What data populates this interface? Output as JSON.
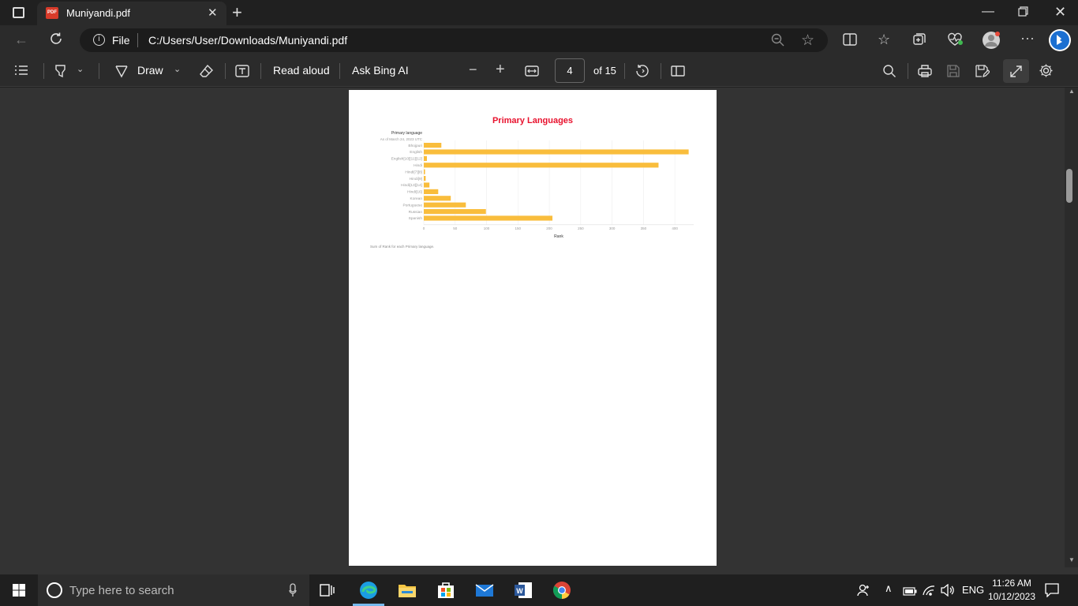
{
  "browser": {
    "tab_title": "Muniyandi.pdf",
    "pdf_badge": "PDF",
    "address_label": "File",
    "url": "C:/Users/User/Downloads/Muniyandi.pdf"
  },
  "pdf_toolbar": {
    "draw_label": "Draw",
    "read_aloud_label": "Read aloud",
    "ask_bing_label": "Ask Bing AI",
    "current_page": "4",
    "page_total": "of 15"
  },
  "chart_data": {
    "type": "bar",
    "orientation": "horizontal",
    "title": "Primary Languages",
    "ylabel": "Primary language",
    "subtitle": "As of March 24, 2023 UTC",
    "xlabel": "Rank",
    "footnote": "Sum of Rank for each Primary language.",
    "categories": [
      "Bhojpuri",
      "English",
      "English[10][11][12]",
      "Hindi",
      "Hindi[7][8]",
      "Hindi[9]",
      "Hindi[13][14]",
      "Hindi[16]",
      "Korean",
      "Portuguese",
      "Russian",
      "Spanish"
    ],
    "values": [
      28,
      422,
      5,
      374,
      2,
      3,
      9,
      23,
      43,
      67,
      99,
      205
    ],
    "xlim": [
      0,
      430
    ],
    "x_ticks": [
      "0",
      "50",
      "100",
      "150",
      "200",
      "250",
      "300",
      "350",
      "400"
    ],
    "bar_color": "#f9bd3c",
    "title_color": "#e8112d",
    "grid": true
  },
  "taskbar": {
    "search_placeholder": "Type here to search",
    "language": "ENG",
    "time": "11:26 AM",
    "date": "10/12/2023"
  }
}
